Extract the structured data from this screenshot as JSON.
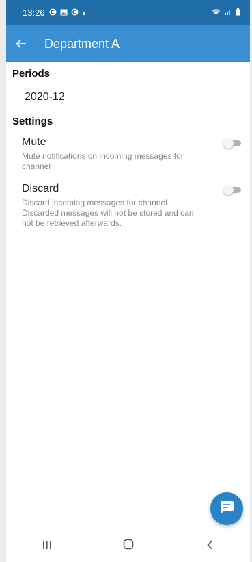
{
  "status_bar": {
    "time": "13:26",
    "icons": [
      "app-c-icon",
      "image-icon",
      "app-c-icon",
      "dot-icon"
    ],
    "right_icons": [
      "wifi-icon",
      "signal-icon",
      "battery-icon"
    ]
  },
  "app_bar": {
    "title": "Department A",
    "back_icon": "arrow-left-icon"
  },
  "periods": {
    "header": "Periods",
    "items": [
      "2020-12"
    ]
  },
  "settings": {
    "header": "Settings",
    "mute": {
      "label": "Mute",
      "description": "Mute notifications on incoming messages for channel",
      "enabled": false
    },
    "discard": {
      "label": "Discard",
      "description": "Discard incoming messages for channel. Discarded messages will not be stored and can not be retrieved afterwards.",
      "enabled": false
    }
  },
  "fab": {
    "icon": "message-icon"
  },
  "nav_bar": {
    "items": [
      "recents-icon",
      "home-icon",
      "back-icon"
    ]
  },
  "colors": {
    "status_bar": "#1f6eaa",
    "app_bar": "#3a8fd2",
    "fab": "#2a83c6"
  }
}
